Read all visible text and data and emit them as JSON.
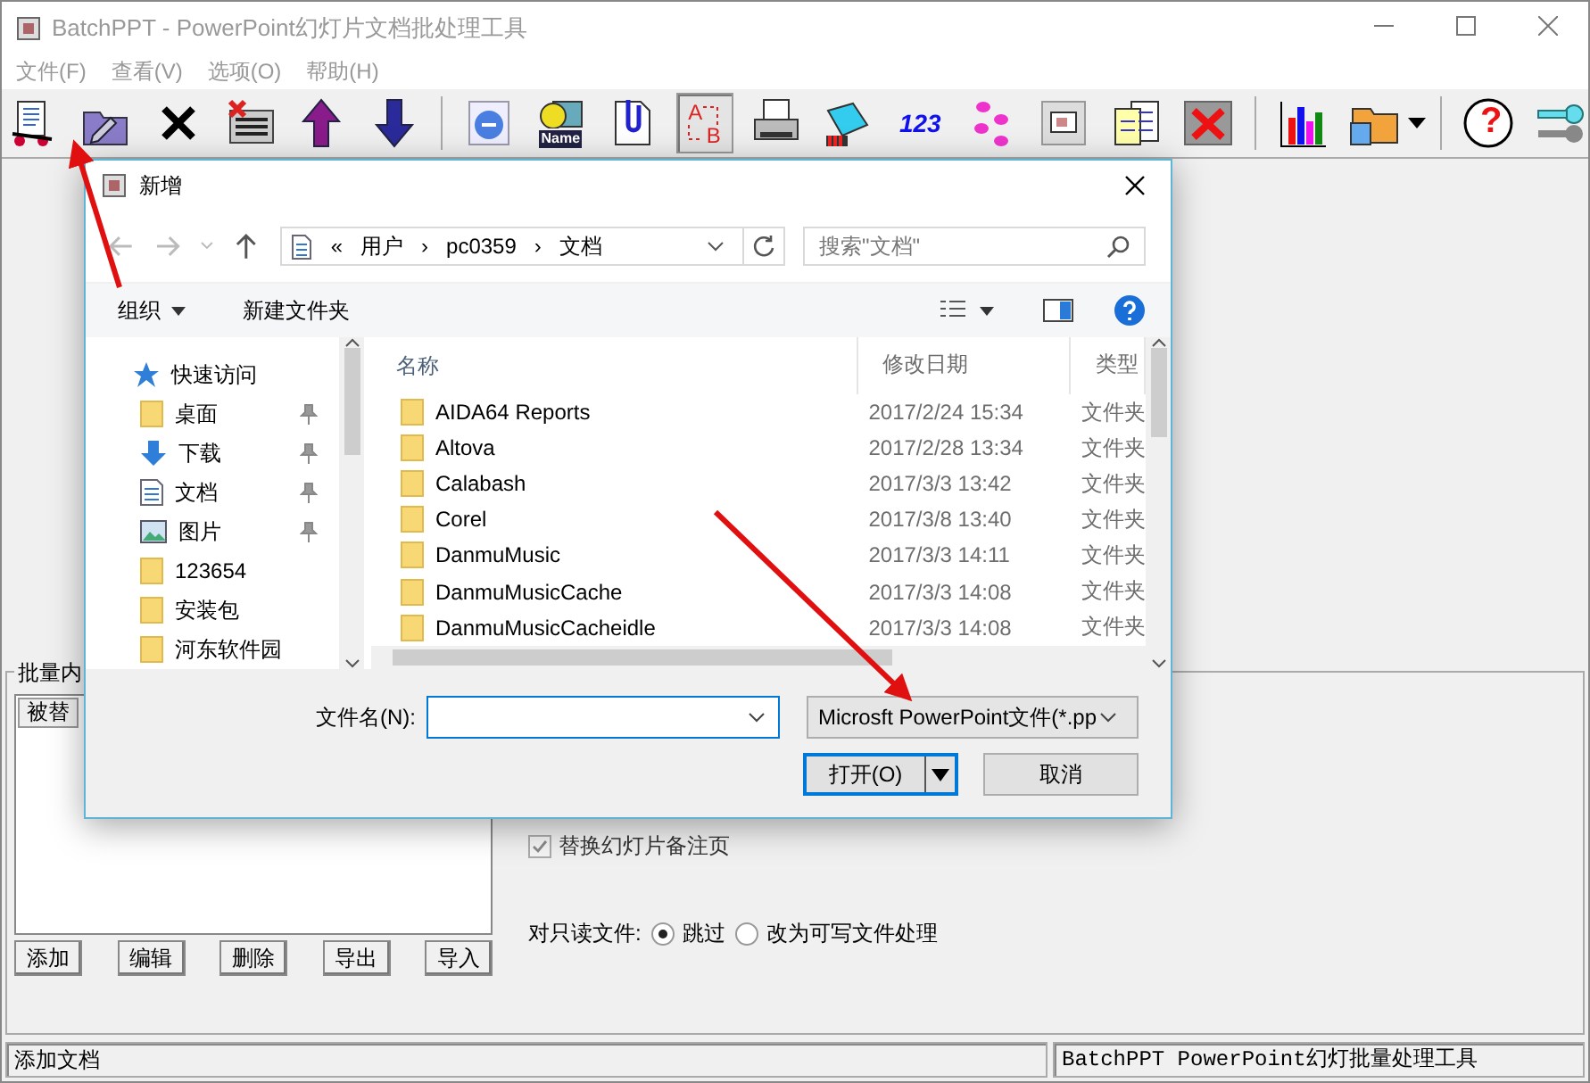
{
  "window": {
    "title": "BatchPPT - PowerPoint幻灯片文档批处理工具"
  },
  "menu": [
    "文件(F)",
    "查看(V)",
    "选项(O)",
    "帮助(H)"
  ],
  "toolbar": [
    {
      "kind": "cart",
      "pressed": false
    },
    {
      "kind": "folder-pen",
      "pressed": false
    },
    {
      "kind": "cross",
      "pressed": false
    },
    {
      "kind": "list-x",
      "pressed": false
    },
    {
      "kind": "up",
      "pressed": false
    },
    {
      "kind": "down",
      "pressed": false
    },
    {
      "kind": "sep"
    },
    {
      "kind": "globe",
      "pressed": false
    },
    {
      "kind": "namecard",
      "label": "Name",
      "pressed": false
    },
    {
      "kind": "clip",
      "pressed": false
    },
    {
      "kind": "letters",
      "labels": [
        "A",
        "B"
      ],
      "pressed": true
    },
    {
      "kind": "printer",
      "pressed": false
    },
    {
      "kind": "bucket",
      "pressed": false
    },
    {
      "kind": "numbers",
      "label": "123",
      "pressed": false
    },
    {
      "kind": "steps",
      "pressed": false
    },
    {
      "kind": "slide",
      "pressed": false
    },
    {
      "kind": "forms",
      "pressed": false
    },
    {
      "kind": "slide-x",
      "pressed": false
    },
    {
      "kind": "sep"
    },
    {
      "kind": "chart",
      "pressed": false
    },
    {
      "kind": "folder-drop",
      "pressed": false
    },
    {
      "kind": "sep"
    },
    {
      "kind": "help",
      "label": "?",
      "pressed": false
    },
    {
      "kind": "keys",
      "pressed": false
    }
  ],
  "group": {
    "label": "批量内",
    "list_header": "被替",
    "buttons": [
      "添加",
      "编辑",
      "删除",
      "导出",
      "导入"
    ],
    "notes_checkbox": {
      "label": "替换幻灯片备注页",
      "checked": true,
      "disabled": true
    },
    "readonly": {
      "label": "对只读文件:",
      "options": [
        {
          "label": "跳过",
          "selected": true
        },
        {
          "label": "改为可写文件处理",
          "selected": false
        }
      ]
    }
  },
  "status_bar": [
    "添加文档",
    "BatchPPT PowerPoint幻灯批量处理工具"
  ],
  "dialog": {
    "title": "新增",
    "breadcrumb": [
      "«",
      "用户",
      "›",
      "pc0359",
      "›",
      "文档"
    ],
    "search": {
      "placeholder": "搜索\"文档\""
    },
    "commands": [
      "组织",
      "新建文件夹"
    ],
    "nav": [
      {
        "label": "快速访问",
        "kind": "star",
        "pinned": false
      },
      {
        "label": "桌面",
        "kind": "folder",
        "pinned": true
      },
      {
        "label": "下载",
        "kind": "download",
        "pinned": true
      },
      {
        "label": "文档",
        "kind": "doc",
        "pinned": true
      },
      {
        "label": "图片",
        "kind": "picture",
        "pinned": true
      },
      {
        "label": "123654",
        "kind": "folder",
        "pinned": false
      },
      {
        "label": "安装包",
        "kind": "folder",
        "pinned": false
      },
      {
        "label": "河东软件园",
        "kind": "folder",
        "pinned": false
      }
    ],
    "columns": [
      "名称",
      "修改日期",
      "类型"
    ],
    "files": [
      {
        "name": "AIDA64 Reports",
        "date": "2017/2/24 15:34",
        "type": "文件夹"
      },
      {
        "name": "Altova",
        "date": "2017/2/28 13:34",
        "type": "文件夹"
      },
      {
        "name": "Calabash",
        "date": "2017/3/3 13:42",
        "type": "文件夹"
      },
      {
        "name": "Corel",
        "date": "2017/3/8 13:40",
        "type": "文件夹"
      },
      {
        "name": "DanmuMusic",
        "date": "2017/3/3 14:11",
        "type": "文件夹"
      },
      {
        "name": "DanmuMusicCache",
        "date": "2017/3/3 14:08",
        "type": "文件夹"
      },
      {
        "name": "DanmuMusicCacheidle",
        "date": "2017/3/3 14:08",
        "type": "文件夹"
      }
    ],
    "filename_label": "文件名(N):",
    "filetype": "Microsft PowerPoint文件(*.pp",
    "buttons": [
      "打开(O)",
      "取消"
    ]
  },
  "annotations": [
    {
      "kind": "arrow"
    },
    {
      "kind": "arrow"
    }
  ]
}
